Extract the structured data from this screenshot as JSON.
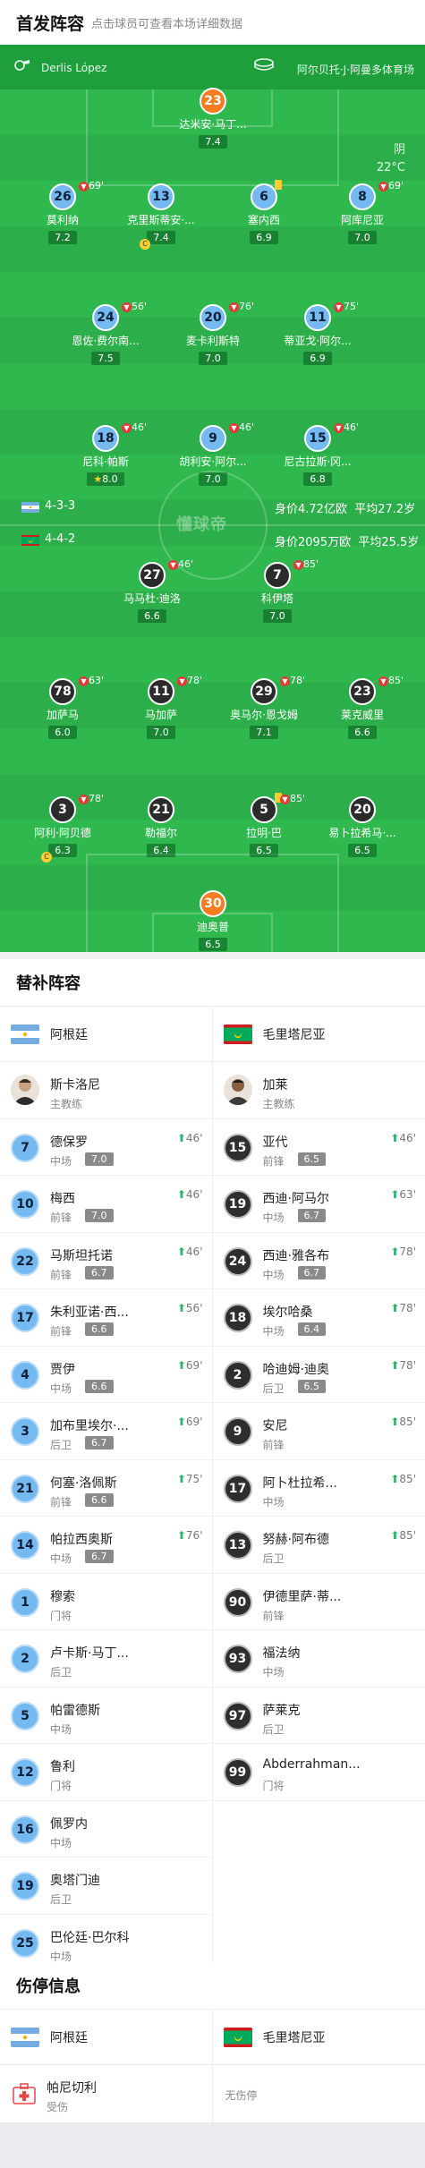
{
  "header": {
    "title": "首发阵容",
    "subtitle": "点击球员可查看本场详细数据"
  },
  "pitch": {
    "referee": "Derlis López",
    "stadium": "阿尔贝托·J·阿曼多体育场",
    "weather": "阴",
    "temp": "22°C",
    "watermark": "懂球帝",
    "home": {
      "formation": "4-3-3",
      "value": "身价4.72亿欧",
      "age": "平均27.2岁"
    },
    "away": {
      "formation": "4-4-2",
      "value": "身价2095万欧",
      "age": "平均25.5岁"
    },
    "players": [
      {
        "id": "a-gk",
        "team": "a",
        "gk": true,
        "num": "23",
        "name": "达米安·马丁...",
        "rating": "7.4"
      },
      {
        "id": "a-lb",
        "team": "a",
        "num": "26",
        "name": "莫利纳",
        "rating": "7.2",
        "sub": "69'"
      },
      {
        "id": "a-cb1",
        "team": "a",
        "num": "13",
        "name": "克里斯蒂安·...",
        "rating": "7.4",
        "captain": "C"
      },
      {
        "id": "a-cb2",
        "team": "a",
        "num": "6",
        "name": "塞内西",
        "rating": "6.9",
        "yellow": true
      },
      {
        "id": "a-rb",
        "team": "a",
        "num": "8",
        "name": "阿库尼亚",
        "rating": "7.0",
        "sub": "69'"
      },
      {
        "id": "a-m1",
        "team": "a",
        "num": "24",
        "name": "恩佐·费尔南...",
        "rating": "7.5",
        "sub": "56'",
        "goal": true
      },
      {
        "id": "a-m2",
        "team": "a",
        "num": "20",
        "name": "麦卡利斯特",
        "rating": "7.0",
        "sub": "76'"
      },
      {
        "id": "a-m3",
        "team": "a",
        "num": "11",
        "name": "蒂亚戈·阿尔...",
        "rating": "6.9",
        "sub": "75'"
      },
      {
        "id": "a-f1",
        "team": "a",
        "num": "18",
        "name": "尼科·帕斯",
        "rating": "8.0",
        "sub": "46'",
        "goal": true,
        "star": true
      },
      {
        "id": "a-f2",
        "team": "a",
        "num": "9",
        "name": "胡利安·阿尔...",
        "rating": "7.0",
        "sub": "46'"
      },
      {
        "id": "a-f3",
        "team": "a",
        "num": "15",
        "name": "尼古拉斯·冈...",
        "rating": "6.8",
        "sub": "46'"
      },
      {
        "id": "b-f1",
        "team": "b",
        "num": "27",
        "name": "马马杜·迪洛",
        "rating": "6.6",
        "sub": "46'"
      },
      {
        "id": "b-f2",
        "team": "b",
        "num": "7",
        "name": "科伊塔",
        "rating": "7.0",
        "sub": "85'"
      },
      {
        "id": "b-m1",
        "team": "b",
        "num": "78",
        "name": "加萨马",
        "rating": "6.0",
        "sub": "63'"
      },
      {
        "id": "b-m2",
        "team": "b",
        "num": "11",
        "name": "马加萨",
        "rating": "7.0",
        "sub": "78'"
      },
      {
        "id": "b-m3",
        "team": "b",
        "num": "29",
        "name": "奥马尔·恩戈姆",
        "rating": "7.1",
        "sub": "78'"
      },
      {
        "id": "b-m4",
        "team": "b",
        "num": "23",
        "name": "莱克威里",
        "rating": "6.6",
        "sub": "85'"
      },
      {
        "id": "b-d1",
        "team": "b",
        "num": "3",
        "name": "阿利·阿贝德",
        "rating": "6.3",
        "sub": "78'",
        "captain": "C"
      },
      {
        "id": "b-d2",
        "team": "b",
        "num": "21",
        "name": "勒福尔",
        "rating": "6.4"
      },
      {
        "id": "b-d3",
        "team": "b",
        "num": "5",
        "name": "拉明·巴",
        "rating": "6.5",
        "sub": "85'",
        "yellow": true
      },
      {
        "id": "b-d4",
        "team": "b",
        "num": "20",
        "name": "易卜拉希马·...",
        "rating": "6.5"
      },
      {
        "id": "b-gk",
        "team": "b",
        "gk": true,
        "num": "30",
        "name": "迪奥普",
        "rating": "6.5"
      }
    ]
  },
  "subs": {
    "title": "替补阵容",
    "home": {
      "team": "阿根廷",
      "coach": {
        "name": "斯卡洛尼",
        "role": "主教练"
      },
      "players": [
        {
          "num": "7",
          "name": "德保罗",
          "pos": "中场",
          "rating": "7.0",
          "min": "46'"
        },
        {
          "num": "10",
          "name": "梅西",
          "pos": "前锋",
          "rating": "7.0",
          "min": "46'"
        },
        {
          "num": "22",
          "name": "马斯坦托诺",
          "pos": "前锋",
          "rating": "6.7",
          "min": "46'"
        },
        {
          "num": "17",
          "name": "朱利亚诺·西...",
          "pos": "前锋",
          "rating": "6.6",
          "min": "56'"
        },
        {
          "num": "4",
          "name": "贾伊",
          "pos": "中场",
          "rating": "6.6",
          "min": "69'"
        },
        {
          "num": "3",
          "name": "加布里埃尔·...",
          "pos": "后卫",
          "rating": "6.7",
          "min": "69'"
        },
        {
          "num": "21",
          "name": "何塞·洛佩斯",
          "pos": "前锋",
          "rating": "6.6",
          "min": "75'"
        },
        {
          "num": "14",
          "name": "帕拉西奥斯",
          "pos": "中场",
          "rating": "6.7",
          "min": "76'"
        },
        {
          "num": "1",
          "name": "穆索",
          "pos": "门将"
        },
        {
          "num": "2",
          "name": "卢卡斯·马丁...",
          "pos": "后卫"
        },
        {
          "num": "5",
          "name": "帕雷德斯",
          "pos": "中场"
        },
        {
          "num": "12",
          "name": "鲁利",
          "pos": "门将"
        },
        {
          "num": "16",
          "name": "佩罗内",
          "pos": "中场"
        },
        {
          "num": "19",
          "name": "奥塔门迪",
          "pos": "后卫"
        },
        {
          "num": "25",
          "name": "巴伦廷·巴尔科",
          "pos": "中场"
        }
      ]
    },
    "away": {
      "team": "毛里塔尼亚",
      "coach": {
        "name": "加莱",
        "role": "主教练"
      },
      "players": [
        {
          "num": "15",
          "name": "亚代",
          "pos": "前锋",
          "rating": "6.5",
          "min": "46'"
        },
        {
          "num": "19",
          "name": "西迪·阿马尔",
          "pos": "中场",
          "rating": "6.7",
          "min": "63'"
        },
        {
          "num": "24",
          "name": "西迪·雅各布",
          "pos": "中场",
          "rating": "6.7",
          "min": "78'"
        },
        {
          "num": "18",
          "name": "埃尔哈桑",
          "pos": "中场",
          "rating": "6.4",
          "min": "78'"
        },
        {
          "num": "2",
          "name": "哈迪姆·迪奥",
          "pos": "后卫",
          "rating": "6.5",
          "min": "78'"
        },
        {
          "num": "9",
          "name": "安尼",
          "pos": "前锋",
          "min": "85'"
        },
        {
          "num": "17",
          "name": "阿卜杜拉希...",
          "pos": "中场",
          "min": "85'"
        },
        {
          "num": "13",
          "name": "努赫·阿布德",
          "pos": "后卫",
          "min": "85'"
        },
        {
          "num": "90",
          "name": "伊德里萨·蒂...",
          "pos": "前锋"
        },
        {
          "num": "93",
          "name": "福法纳",
          "pos": "中场"
        },
        {
          "num": "97",
          "name": "萨莱克",
          "pos": "后卫"
        },
        {
          "num": "99",
          "name": "Abderrahman...",
          "pos": "门将"
        }
      ]
    }
  },
  "injuries": {
    "title": "伤停信息",
    "home": {
      "team": "阿根廷",
      "player": {
        "name": "帕尼切利",
        "status": "受伤"
      }
    },
    "away": {
      "team": "毛里塔尼亚",
      "none": "无伤停"
    }
  },
  "colors": {
    "pitch": "#2fb84e",
    "home_kit": "#74b9f0",
    "away_kit": "#2b2b2b",
    "gk_kit": "#f57c1f",
    "sub_up": "#2db36b"
  }
}
